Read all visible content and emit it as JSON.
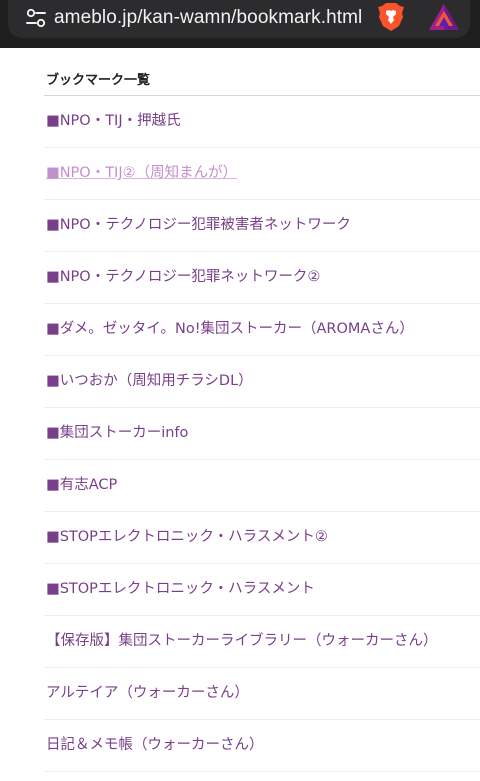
{
  "browser": {
    "url": "ameblo.jp/kan-wamn/bookmark.html",
    "icons": {
      "site_settings": "site-settings-icon",
      "shield": "brave-shield-icon",
      "rewards": "brave-rewards-icon"
    },
    "colors": {
      "toolbar": "#1f1f1f",
      "url_pill": "#2c2c2e",
      "shield": "#fb542b",
      "rewards": "#a1208f"
    }
  },
  "page": {
    "section_title": "ブックマーク一覧",
    "colors": {
      "link": "#7a3f8a",
      "visited_link": "#c48fcd",
      "separator": "#ececec"
    },
    "bookmarks": [
      {
        "label": "■NPO・TIJ・押越氏"
      },
      {
        "label": "■NPO・TIJ②（周知まんが）"
      },
      {
        "label": "■NPO・テクノロジー犯罪被害者ネットワーク"
      },
      {
        "label": "■NPO・テクノロジー犯罪ネットワーク②"
      },
      {
        "label": "■ダメ。ゼッタイ。No!集団ストーカー（AROMAさん）"
      },
      {
        "label": "■いつおか（周知用チラシDL）"
      },
      {
        "label": "■集団ストーカーinfo"
      },
      {
        "label": "■有志ACP"
      },
      {
        "label": "■STOPエレクトロニック・ハラスメント②"
      },
      {
        "label": "■STOPエレクトロニック・ハラスメント"
      },
      {
        "label": "【保存版】集団ストーカーライブラリー（ウォーカーさん）"
      },
      {
        "label": "アルテイア（ウォーカーさん）"
      },
      {
        "label": "日記＆メモ帳（ウォーカーさん）"
      }
    ]
  }
}
